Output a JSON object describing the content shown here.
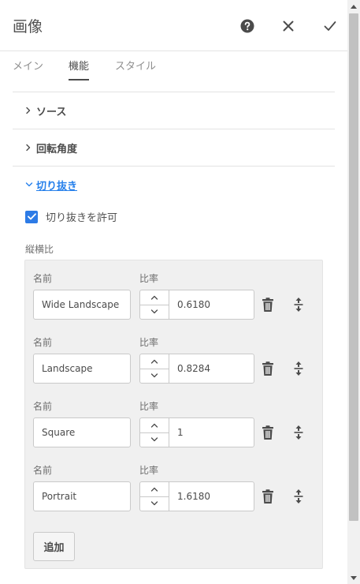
{
  "header": {
    "title": "画像",
    "help_icon": "help-circle-icon",
    "close_icon": "close-icon",
    "confirm_icon": "checkmark-icon"
  },
  "tabs": [
    {
      "label": "メイン",
      "active": false
    },
    {
      "label": "機能",
      "active": true
    },
    {
      "label": "スタイル",
      "active": false
    }
  ],
  "sections": {
    "source": {
      "label": "ソース",
      "expanded": false
    },
    "rotation": {
      "label": "回転角度",
      "expanded": false
    },
    "crop": {
      "label": "切り抜き",
      "expanded": true
    }
  },
  "crop": {
    "allow_label": "切り抜きを許可",
    "allow_checked": true,
    "aspect_label": "縦横比",
    "name_label": "名前",
    "ratio_label": "比率",
    "rows": [
      {
        "name": "Wide Landscape",
        "ratio": "0.6180"
      },
      {
        "name": "Landscape",
        "ratio": "0.8284"
      },
      {
        "name": "Square",
        "ratio": "1"
      },
      {
        "name": "Portrait",
        "ratio": "1.6180"
      }
    ],
    "add_label": "追加"
  },
  "colors": {
    "accent": "#2680eb",
    "checkbox": "#2d7be6",
    "panel_bg": "#f0f0f0"
  }
}
